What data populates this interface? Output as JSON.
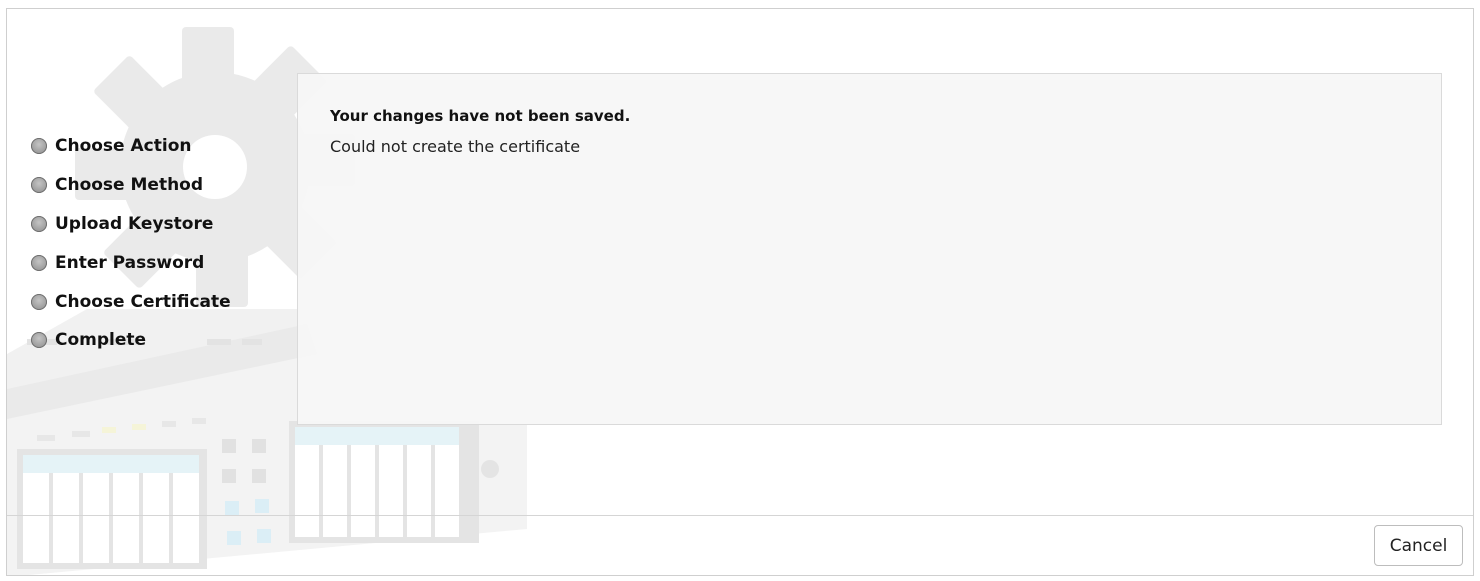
{
  "steps": [
    {
      "label": "Choose Action"
    },
    {
      "label": "Choose Method"
    },
    {
      "label": "Upload Keystore"
    },
    {
      "label": "Enter Password"
    },
    {
      "label": "Choose Certificate"
    },
    {
      "label": "Complete"
    }
  ],
  "message": {
    "title": "Your changes have not been saved.",
    "body": "Could not create the certificate"
  },
  "footer": {
    "cancel_label": "Cancel"
  },
  "icons": {
    "watermark": "gear-and-device-watermark-icon",
    "step_bullet": "gray-circle-icon"
  }
}
